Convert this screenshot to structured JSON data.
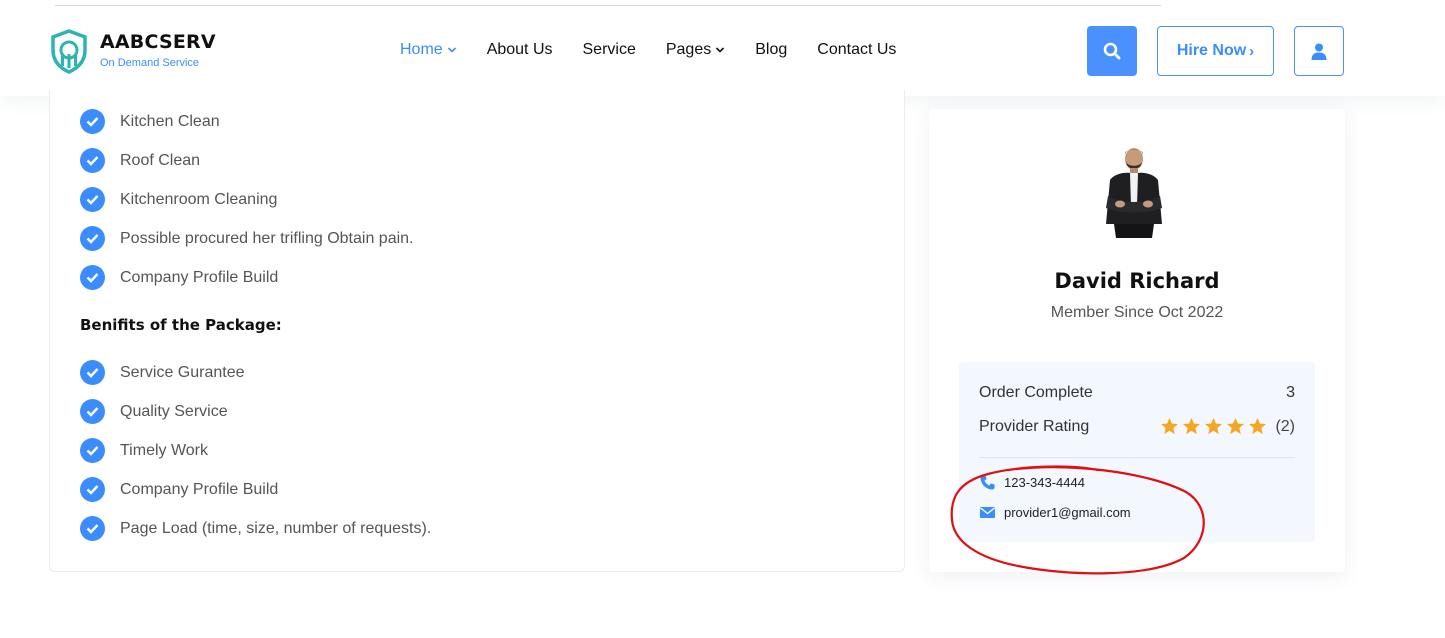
{
  "brand": {
    "name": "AABCSERV",
    "tagline": "On Demand Service",
    "icon": "wrench-shield-logo-icon",
    "accent_color": "#3b8dff"
  },
  "nav": {
    "items": [
      {
        "label": "Home",
        "active": true,
        "dropdown": true
      },
      {
        "label": "About Us",
        "active": false,
        "dropdown": false
      },
      {
        "label": "Service",
        "active": false,
        "dropdown": false
      },
      {
        "label": "Pages",
        "active": false,
        "dropdown": true
      },
      {
        "label": "Blog",
        "active": false,
        "dropdown": false
      },
      {
        "label": "Contact Us",
        "active": false,
        "dropdown": false
      }
    ]
  },
  "header_actions": {
    "search_icon": "search-icon",
    "hire_label": "Hire Now",
    "hire_arrow": "›",
    "user_icon": "user-icon"
  },
  "package": {
    "includes": [
      "Kitchen Clean",
      "Roof Clean",
      "Kitchenroom Cleaning",
      "Possible procured her trifling Obtain pain.",
      "Company Profile Build"
    ],
    "benefits_heading": "Benifits of the Package:",
    "benefits": [
      "Service Gurantee",
      "Quality Service",
      "Timely Work",
      "Company Profile Build",
      "Page Load (time, size, number of requests)."
    ]
  },
  "provider": {
    "name": "David Richard",
    "member_since": "Member Since Oct 2022",
    "order_complete_label": "Order Complete",
    "order_complete_value": "3",
    "rating_label": "Provider Rating",
    "rating_stars": 5,
    "rating_count": "(2)",
    "phone": "123-343-4444",
    "email": "provider1@gmail.com",
    "star_color": "#f5a623"
  },
  "annotation": {
    "color": "#e01010",
    "shape": "hand-drawn-ellipse"
  }
}
